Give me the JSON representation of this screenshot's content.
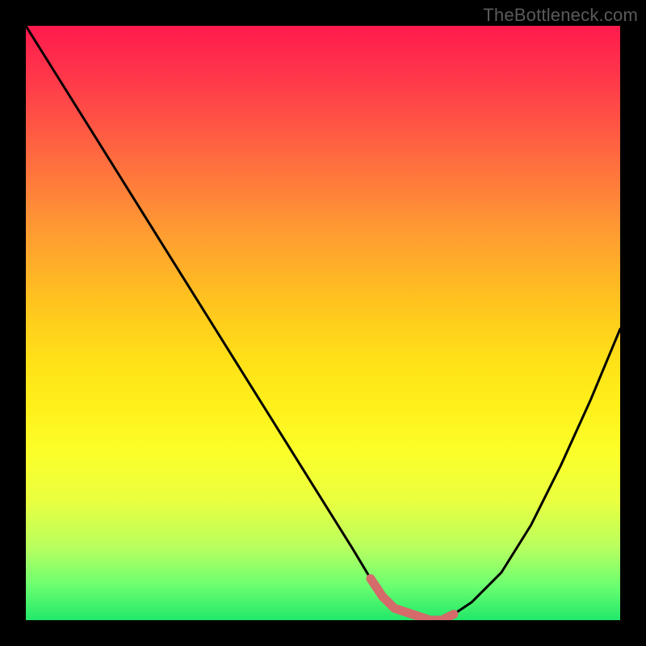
{
  "watermark": {
    "text": "TheBottleneck.com"
  },
  "chart_data": {
    "type": "line",
    "title": "",
    "xlabel": "",
    "ylabel": "",
    "xlim": [
      0,
      100
    ],
    "ylim": [
      0,
      100
    ],
    "series": [
      {
        "name": "main-curve",
        "color": "#000000",
        "x": [
          0,
          5,
          10,
          15,
          20,
          25,
          30,
          35,
          40,
          45,
          50,
          55,
          58,
          60,
          62,
          65,
          68,
          70,
          72,
          75,
          80,
          85,
          90,
          95,
          100
        ],
        "values": [
          100,
          92,
          84,
          76,
          68,
          60,
          52,
          44,
          36,
          28,
          20,
          12,
          7,
          4,
          2,
          1,
          0,
          0,
          1,
          3,
          8,
          16,
          26,
          37,
          49
        ]
      },
      {
        "name": "highlight-segment",
        "color": "#d46a6a",
        "x": [
          58,
          60,
          62,
          65,
          68,
          70,
          72
        ],
        "values": [
          7,
          4,
          2,
          1,
          0,
          0,
          1
        ]
      }
    ],
    "annotations": []
  }
}
